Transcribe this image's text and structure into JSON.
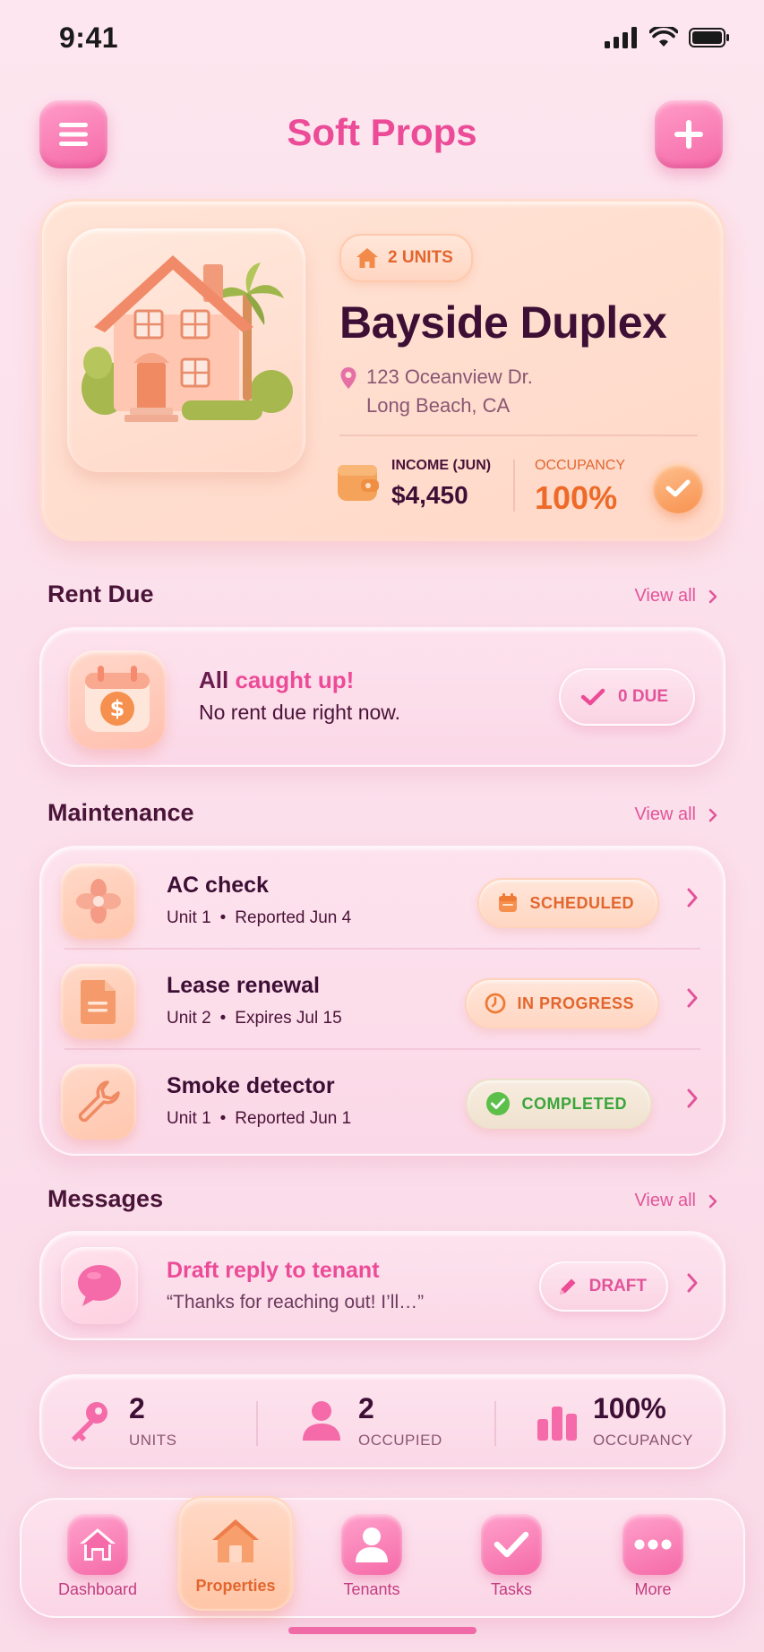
{
  "status_bar": {
    "time": "9:41"
  },
  "header": {
    "title": "Soft Props"
  },
  "property": {
    "units_badge": "2 UNITS",
    "name": "Bayside Duplex",
    "address_line1": "123 Oceanview Dr.",
    "address_line2": "Long Beach, CA",
    "income_label": "INCOME (JUN)",
    "income_value": "$4,450",
    "occupancy_label": "OCCUPANCY",
    "occupancy_value": "100%"
  },
  "rent_due": {
    "section_title": "Rent Due",
    "view_all": "View all",
    "title_prefix": "All",
    "title_accent": "caught up!",
    "subtitle": "No rent due right now.",
    "due_badge": "0 DUE"
  },
  "maintenance": {
    "section_title": "Maintenance",
    "view_all": "View all",
    "items": [
      {
        "title": "AC check",
        "unit": "Unit 1",
        "detail": "Reported Jun 4",
        "status": "SCHEDULED",
        "icon": "fan-icon"
      },
      {
        "title": "Lease renewal",
        "unit": "Unit 2",
        "detail": "Expires Jul 15",
        "status": "IN PROGRESS",
        "icon": "document-icon"
      },
      {
        "title": "Smoke detector",
        "unit": "Unit 1",
        "detail": "Reported Jun 1",
        "status": "COMPLETED",
        "icon": "wrench-icon"
      }
    ]
  },
  "messages": {
    "section_title": "Messages",
    "view_all": "View all",
    "title": "Draft reply to tenant",
    "preview": "“Thanks for reaching out! I’ll…”",
    "badge": "DRAFT"
  },
  "stats": [
    {
      "value": "2",
      "label": "UNITS",
      "icon": "key-icon"
    },
    {
      "value": "2",
      "label": "OCCUPIED",
      "icon": "person-icon"
    },
    {
      "value": "100%",
      "label": "OCCUPANCY",
      "icon": "bar-chart-icon"
    }
  ],
  "tabs": [
    {
      "label": "Dashboard",
      "icon": "home-icon"
    },
    {
      "label": "Properties",
      "icon": "home-icon",
      "active": true
    },
    {
      "label": "Tenants",
      "icon": "person-icon"
    },
    {
      "label": "Tasks",
      "icon": "check-icon"
    },
    {
      "label": "More",
      "icon": "dots-icon"
    }
  ],
  "colors": {
    "accent_pink": "#ec4b97",
    "accent_orange": "#ee6a28",
    "success_green": "#3aa53a",
    "background": "#fde6ef"
  }
}
